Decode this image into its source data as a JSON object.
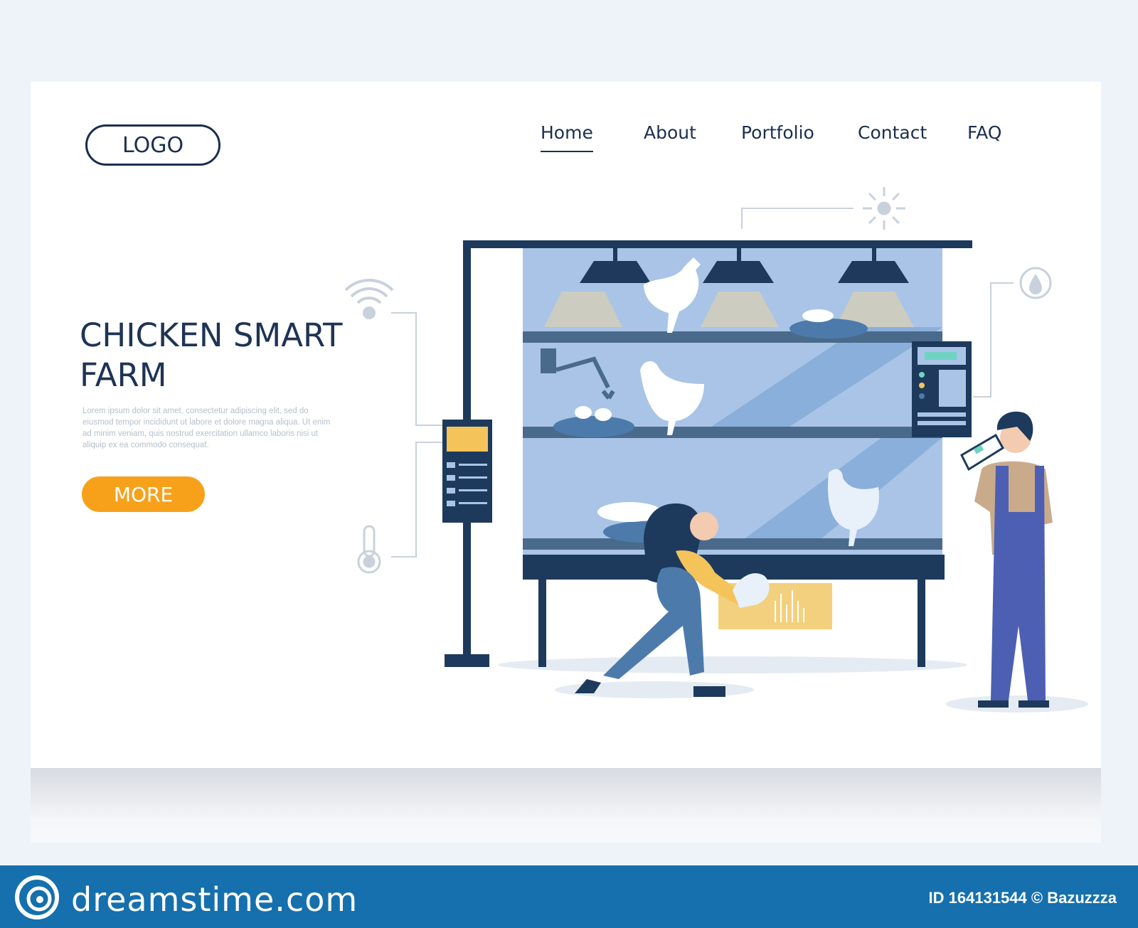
{
  "header": {
    "logo_text": "LOGO",
    "nav": [
      {
        "label": "Home",
        "active": true
      },
      {
        "label": "About"
      },
      {
        "label": "Portfolio"
      },
      {
        "label": "Contact"
      },
      {
        "label": "FAQ"
      }
    ]
  },
  "hero": {
    "title_line1": "CHICKEN SMART",
    "title_line2": "FARM",
    "body": "Lorem ipsum dolor sit amet, consectetur adipiscing elit, sed do eiusmod tempor incididunt ut labore et dolore magna aliqua. Ut enim ad minim veniam, quis nostrud exercitation ullamco laboris nisi ut aliquip ex ea commodo consequat.",
    "button_label": "MORE"
  },
  "footer": {
    "brand": "dreamstime.com",
    "credit": "ID 164131544 © Bazuzzza"
  },
  "icons": [
    "wifi-icon",
    "thermometer-icon",
    "sun-icon",
    "water-drop-icon",
    "dreamstime-logo-icon"
  ],
  "colors": {
    "navy": "#1b2f4e",
    "accent": "#f7a11b",
    "footer": "#1570ad",
    "panel": "#a9c4e6"
  }
}
